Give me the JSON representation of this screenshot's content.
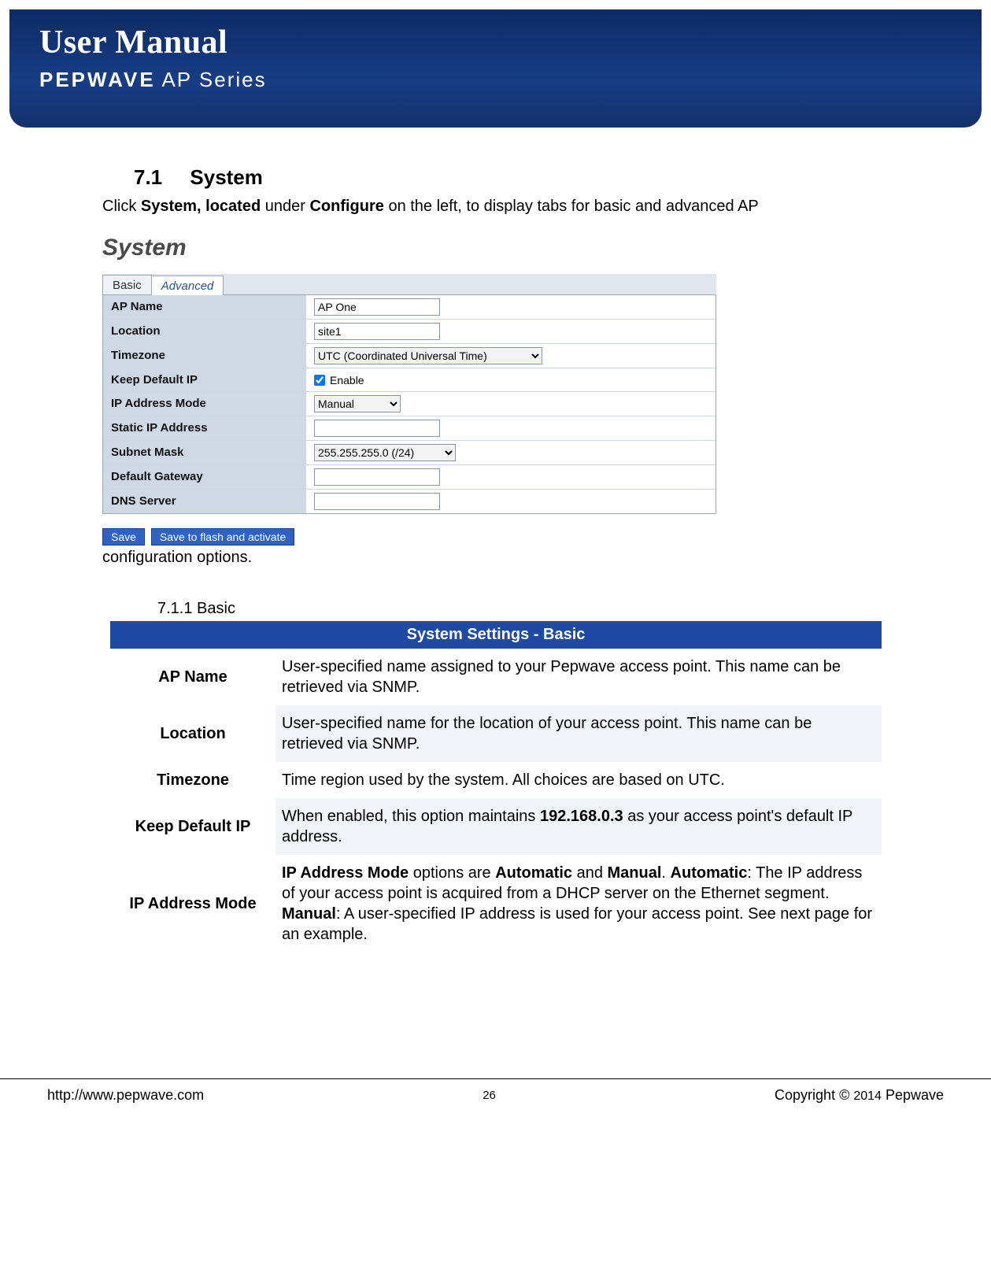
{
  "header": {
    "title": "User Manual",
    "brand_bold": "PEPWAVE",
    "brand_thin": " AP Series"
  },
  "section": {
    "number": "7.1",
    "title": "System",
    "intro_pre": "Click ",
    "intro_b1": "System, located",
    "intro_mid": " under ",
    "intro_b2": "Configure",
    "intro_post": " on the left, to display tabs for basic and advanced AP",
    "config_tail": "configuration options."
  },
  "shot": {
    "heading": "System",
    "tabs": {
      "basic": "Basic",
      "advanced": "Advanced"
    },
    "labels": {
      "ap_name": "AP Name",
      "location": "Location",
      "timezone": "Timezone",
      "keep_default_ip": "Keep Default IP",
      "ip_mode": "IP Address Mode",
      "static_ip": "Static IP Address",
      "subnet": "Subnet Mask",
      "gateway": "Default Gateway",
      "dns": "DNS Server"
    },
    "values": {
      "ap_name": "AP One",
      "location": "site1",
      "timezone": "UTC (Coordinated Universal Time)",
      "keep_default_ip_checked": "true",
      "enable_text": "Enable",
      "ip_mode": "Manual",
      "static_ip": "",
      "subnet": "255.255.255.0 (/24)",
      "gateway": "",
      "dns": ""
    },
    "buttons": {
      "save": "Save",
      "save_flash": "Save to flash and activate"
    }
  },
  "subsection": {
    "number": "7.1.1",
    "title": "Basic"
  },
  "table": {
    "header": "System Settings - Basic",
    "rows": [
      {
        "key": "AP Name",
        "desc": "User-specified name assigned to your Pepwave access point. This name can be retrieved via SNMP."
      },
      {
        "key": "Location",
        "desc": "User-specified name for the location of your access point. This name can be retrieved via SNMP."
      },
      {
        "key": "Timezone",
        "desc": "Time region used by the system. All choices are based on UTC."
      },
      {
        "key": "Keep Default IP",
        "desc_pre": "When enabled, this option maintains ",
        "desc_b": "192.168.0.3",
        "desc_post": " as your access point's default IP address."
      },
      {
        "key": "IP Address Mode",
        "seg": [
          {
            "b": "IP Address Mode"
          },
          {
            "t": " options are "
          },
          {
            "b": "Automatic"
          },
          {
            "t": " and "
          },
          {
            "b": "Manual"
          },
          {
            "t": ". "
          },
          {
            "b": "Automatic"
          },
          {
            "t": ": The IP address of your access point is acquired from a DHCP server on the Ethernet segment. "
          },
          {
            "b": "Manual"
          },
          {
            "t": ": A user-specified IP address is used for your access point. See next page for an example."
          }
        ]
      }
    ]
  },
  "footer": {
    "url": "http://www.pepwave.com",
    "page": "26",
    "copyright_pre": "Copyright © ",
    "year": "2014",
    "copyright_post": " Pepwave"
  }
}
